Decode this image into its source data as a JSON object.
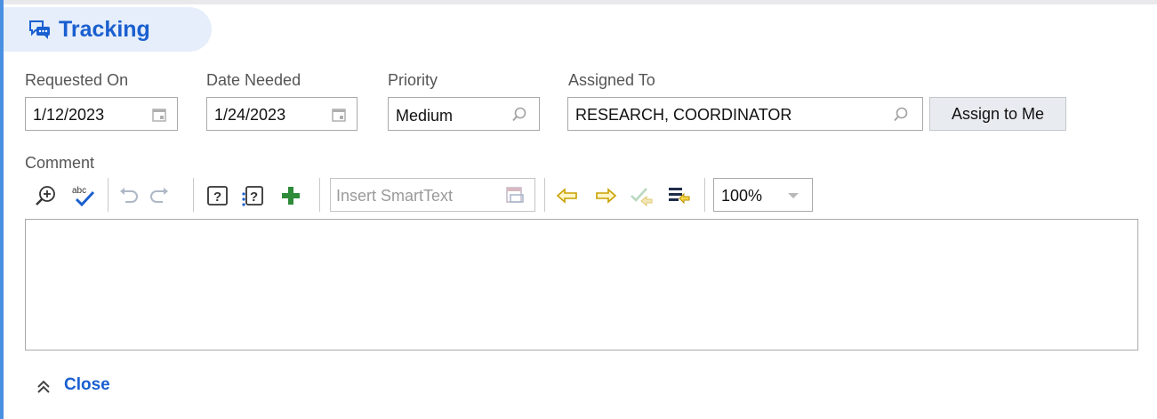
{
  "section": {
    "title": "Tracking",
    "icon": "chat-bubbles-icon"
  },
  "fields": {
    "requested_on": {
      "label": "Requested On",
      "value": "1/12/2023",
      "icon": "calendar-icon"
    },
    "date_needed": {
      "label": "Date Needed",
      "value": "1/24/2023",
      "icon": "calendar-icon"
    },
    "priority": {
      "label": "Priority",
      "value": "Medium",
      "icon": "search-icon"
    },
    "assigned_to": {
      "label": "Assigned To",
      "value": "RESEARCH, COORDINATOR",
      "icon": "search-icon"
    }
  },
  "assign_button": {
    "label": "Assign to Me"
  },
  "comment": {
    "label": "Comment",
    "toolbar": {
      "icons": [
        "zoom-in-icon",
        "spellcheck-icon",
        "undo-icon",
        "redo-icon",
        "help-field-icon",
        "help-next-field-icon",
        "add-icon",
        "previous-field-icon",
        "next-field-icon",
        "accept-field-icon",
        "insert-text-icon"
      ],
      "smarttext_label": "Insert SmartText",
      "zoom": {
        "value": "100%"
      }
    },
    "text": ""
  },
  "close": {
    "label": "Close",
    "icon": "double-chevron-up-icon"
  },
  "colors": {
    "accent": "#1a5fd0",
    "header_bg": "#e5eefa",
    "left_bar": "#4a90e2",
    "green": "#2e8b3a",
    "yellow": "#d4a017"
  }
}
